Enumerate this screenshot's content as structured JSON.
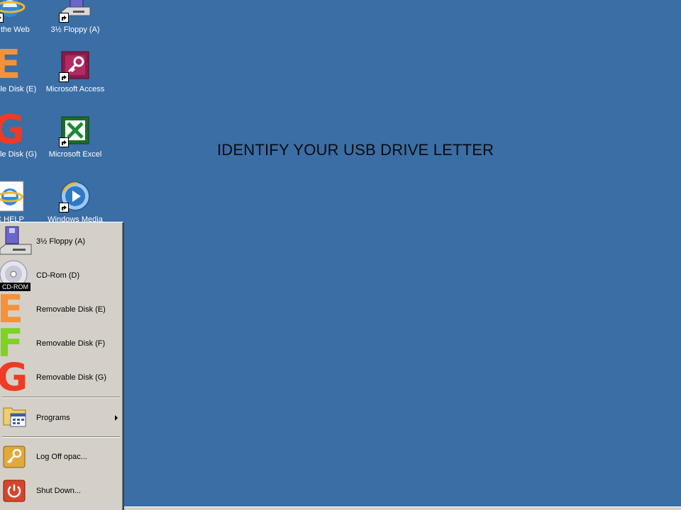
{
  "desktop": {
    "background_color": "#3a6ea5",
    "banner_text": "IDENTIFY YOUR USB DRIVE LETTER",
    "icons": [
      {
        "name": "browse-web",
        "label": "se the Web",
        "icon": "internet-explorer-icon"
      },
      {
        "name": "floppy-a",
        "label": "3½ Floppy (A)",
        "icon": "floppy-drive-icon"
      },
      {
        "name": "removable-e",
        "label": "ovable Disk (E)",
        "icon": "drive-letter-e-icon"
      },
      {
        "name": "ms-access",
        "label": "Microsoft Access",
        "icon": "access-key-icon"
      },
      {
        "name": "removable-g",
        "label": "ovable Disk (G)",
        "icon": "drive-letter-g-icon"
      },
      {
        "name": "ms-excel",
        "label": "Microsoft Excel",
        "icon": "excel-icon"
      },
      {
        "name": "ic-help",
        "label": "C HELP",
        "icon": "internet-explorer-icon"
      },
      {
        "name": "windows-media",
        "label": "Windows Media",
        "icon": "media-player-icon"
      }
    ]
  },
  "start_menu": {
    "items": [
      {
        "label": "3½ Floppy (A)",
        "icon": "floppy-drive-icon"
      },
      {
        "label": "CD-Rom (D)",
        "icon": "cd-rom-icon",
        "badge": "CD-ROM"
      },
      {
        "label": "Removable Disk (E)",
        "icon": "drive-letter-e-icon"
      },
      {
        "label": "Removable Disk (F)",
        "icon": "drive-letter-f-icon"
      },
      {
        "label": "Removable Disk (G)",
        "icon": "drive-letter-g-icon"
      },
      {
        "label": "Programs",
        "icon": "programs-folder-icon"
      },
      {
        "label": "Log Off opac...",
        "icon": "log-off-key-icon"
      },
      {
        "label": "Shut Down...",
        "icon": "shut-down-icon"
      }
    ]
  },
  "letter_colors": {
    "E": "#f5913a",
    "F": "#7ed321",
    "G": "#ee3b24"
  }
}
